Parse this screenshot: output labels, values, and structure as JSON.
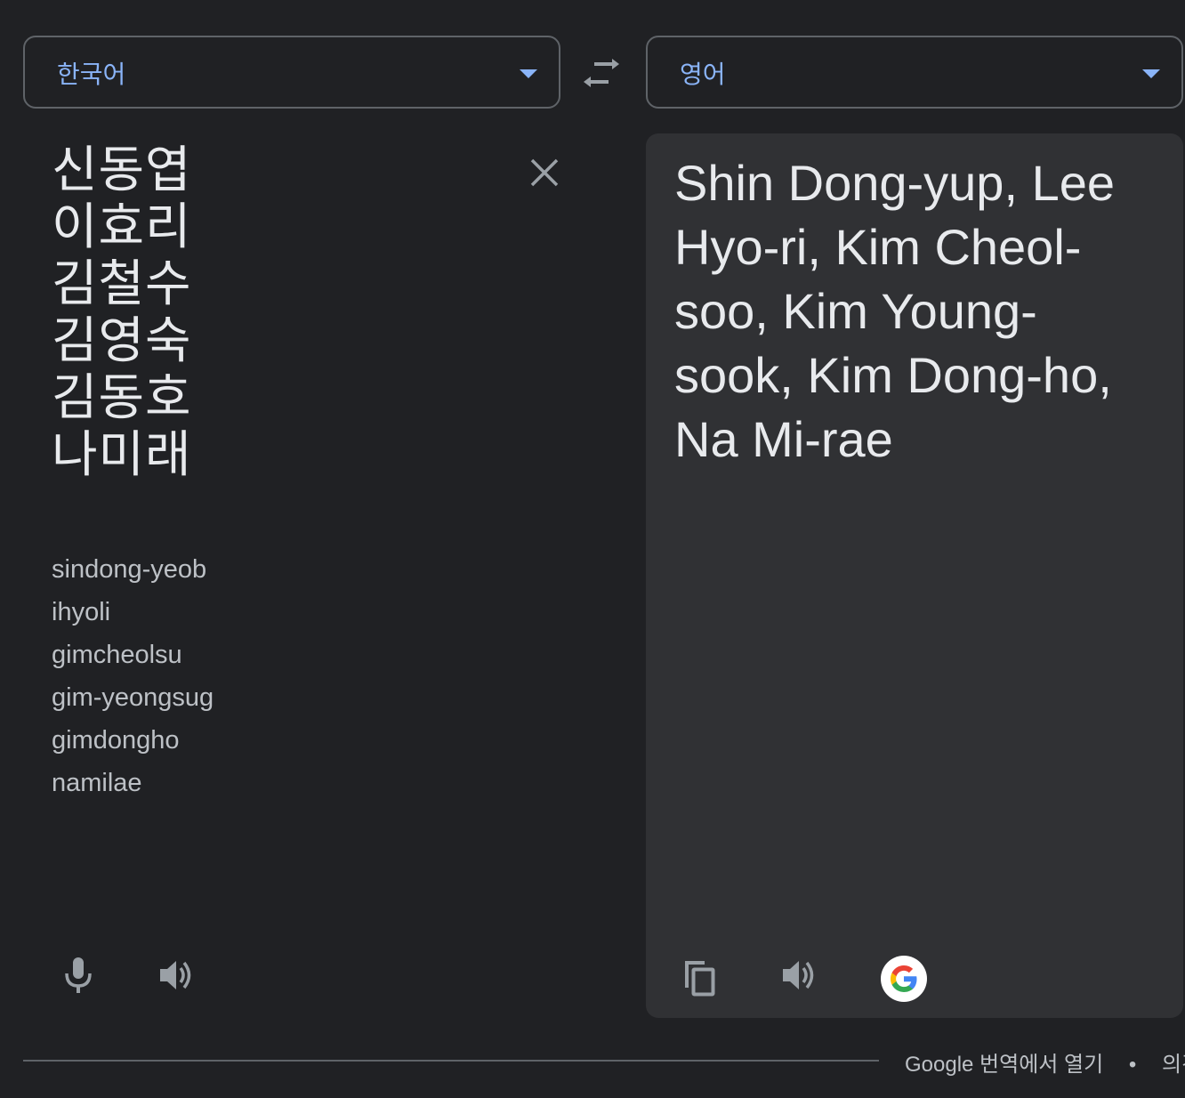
{
  "source_lang": {
    "label": "한국어"
  },
  "target_lang": {
    "label": "영어"
  },
  "source": {
    "text": "신동엽\n이효리\n김철수\n김영숙\n김동호\n나미래",
    "romanization": [
      "sindong-yeob",
      "ihyoli",
      "gimcheolsu",
      "gim-yeongsug",
      "gimdongho",
      "namilae"
    ]
  },
  "target": {
    "text": "Shin Dong-yup, Lee Hyo-ri, Kim Cheol-soo, Kim Young-sook, Kim Dong-ho, Na Mi-rae"
  },
  "footer": {
    "open_link": "Google 번역에서 열기",
    "separator": "•",
    "feedback_link": "의견"
  },
  "colors": {
    "background": "#202124",
    "target_panel": "#303134",
    "accent": "#8ab4f8",
    "icon": "#9aa0a6"
  }
}
